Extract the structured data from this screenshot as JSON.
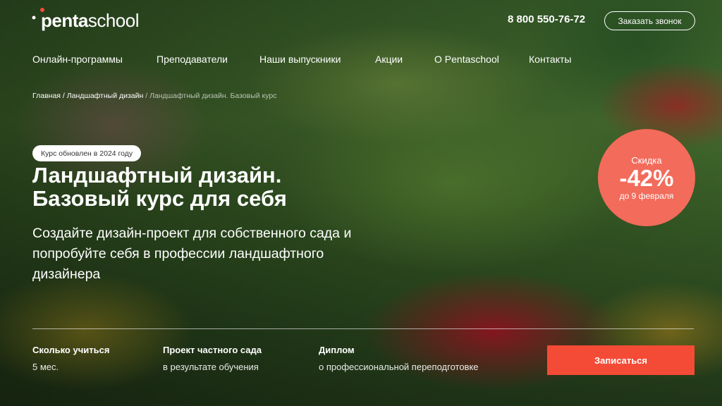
{
  "header": {
    "logo_bold": "penta",
    "logo_light": "school",
    "phone": "8 800 550-76-72",
    "call_button": "Заказать звонок"
  },
  "nav": {
    "items": [
      "Онлайн-программы",
      "Преподаватели",
      "Наши выпускники",
      "Акции",
      "О Pentaschool",
      "Контакты"
    ]
  },
  "breadcrumbs": {
    "home": "Главная",
    "sep1": " / ",
    "section": "Ландшафтный дизайн",
    "sep2": " / ",
    "current": "Ландшафтный дизайн. Базовый курс"
  },
  "hero": {
    "badge": "Курс обновлен в 2024 году",
    "title_line1": "Ландшафтный дизайн.",
    "title_line2": "Базовый курс для себя",
    "subtitle": "Создайте дизайн-проект для собственного сада и попробуйте себя в профессии ландшафтного дизайнера"
  },
  "discount": {
    "label": "Скидка",
    "value": "-42%",
    "until": "до 9 февраля"
  },
  "features": [
    {
      "title": "Сколько учиться",
      "value": "5 мес."
    },
    {
      "title": "Проект частного сада",
      "value": "в результате обучения"
    },
    {
      "title": "Диплом",
      "value": "о профессиональной переподготовке"
    }
  ],
  "cta": {
    "label": "Записаться"
  },
  "colors": {
    "accent": "#f44b36",
    "discount": "#f26b5b"
  }
}
